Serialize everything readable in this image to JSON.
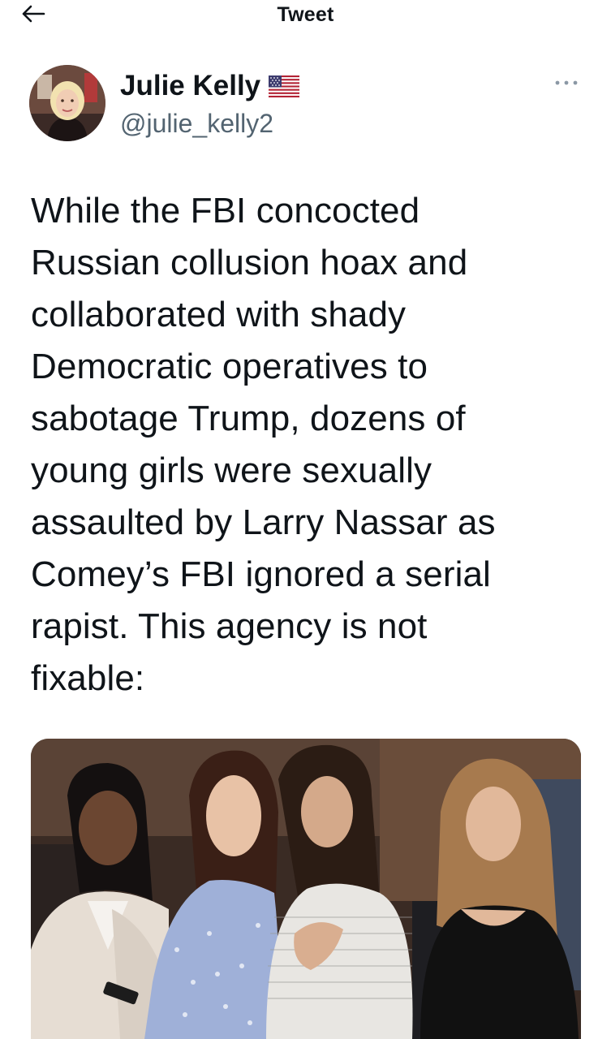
{
  "header": {
    "title": "Tweet",
    "back_icon": "arrow-left-icon"
  },
  "author": {
    "name": "Julie Kelly",
    "handle": "@julie_kelly2",
    "badge_icon": "us-flag-icon",
    "more_icon": "more-horizontal-icon"
  },
  "tweet": {
    "text": "While the FBI concocted\nRussian collusion hoax and\ncollaborated with shady\nDemocratic operatives to\nsabotage Trump, dozens of\nyoung girls were sexually\nassaulted by Larry Nassar as\nComey’s FBI ignored a serial\nrapist. This agency is not\nfixable:"
  },
  "colors": {
    "text": "#0f1419",
    "secondary_text": "#536471"
  }
}
